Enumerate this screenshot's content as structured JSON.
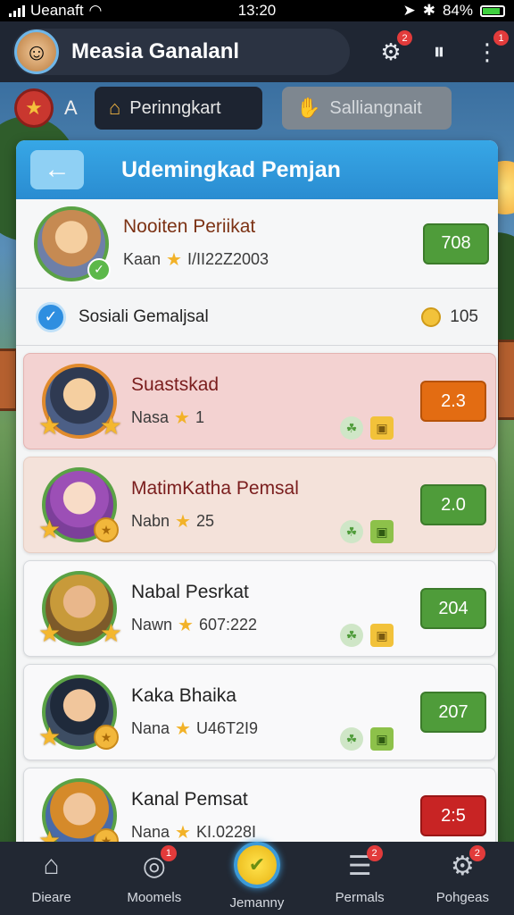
{
  "status_bar": {
    "carrier": "Ueanaft",
    "time": "13:20",
    "battery": "84%"
  },
  "header": {
    "title": "Measia Ganalanl",
    "avatar_icon": "hero-avatar",
    "icons": [
      {
        "name": "gear-icon",
        "badge": "2"
      },
      {
        "name": "pause-icon",
        "badge": ""
      },
      {
        "name": "more-icon",
        "badge": "1"
      }
    ]
  },
  "tab_row": {
    "letter": "A",
    "tabs": [
      {
        "label": "Perinngkart",
        "icon": "house-icon",
        "state": "active"
      },
      {
        "label": "Salliangnait",
        "icon": "hand-icon",
        "state": "inactive"
      }
    ]
  },
  "panel": {
    "title": "Udemingkad Pemjan",
    "back_icon": "arrow-left-icon"
  },
  "top_player": {
    "name": "Nooiten Periikat",
    "label": "Kaan",
    "value": "I/II22Z2003",
    "score": "708"
  },
  "social_row": {
    "label": "Sosiali Gemaljsal",
    "coins": "105"
  },
  "players": [
    {
      "name": "Suastskad",
      "label": "Nasa",
      "value": "1",
      "score": "2.3",
      "score_color": "#e36c12",
      "bg": "#f3d2d1"
    },
    {
      "name": "MatimKatha Pemsal",
      "label": "Nabn",
      "value": "25",
      "score": "2.0",
      "score_color": "#4f9c3a",
      "bg": "#f4e2da"
    },
    {
      "name": "Nabal Pesrkat",
      "label": "Nawn",
      "value": "607:222",
      "score": "204",
      "score_color": "#4f9c3a",
      "bg": "#f9f9fa"
    },
    {
      "name": "Kaka Bhaika",
      "label": "Nana",
      "value": "U46T2I9",
      "score": "207",
      "score_color": "#4f9c3a",
      "bg": "#f9f9fa"
    },
    {
      "name": "Kanal Pemsat",
      "label": "Nana",
      "value": "KI.0228I",
      "score": "2:5",
      "score_color": "#c82424",
      "bg": "#f9f9fa"
    }
  ],
  "bottom_nav": [
    {
      "label": "Dieare",
      "icon": "home-icon",
      "badge": ""
    },
    {
      "label": "Moomels",
      "icon": "search-icon",
      "badge": "1"
    },
    {
      "label": "Jemanny",
      "icon": "center-play-icon",
      "badge": ""
    },
    {
      "label": "Permals",
      "icon": "list-icon",
      "badge": "2"
    },
    {
      "label": "Pohgeas",
      "icon": "settings-icon",
      "badge": "2"
    }
  ]
}
